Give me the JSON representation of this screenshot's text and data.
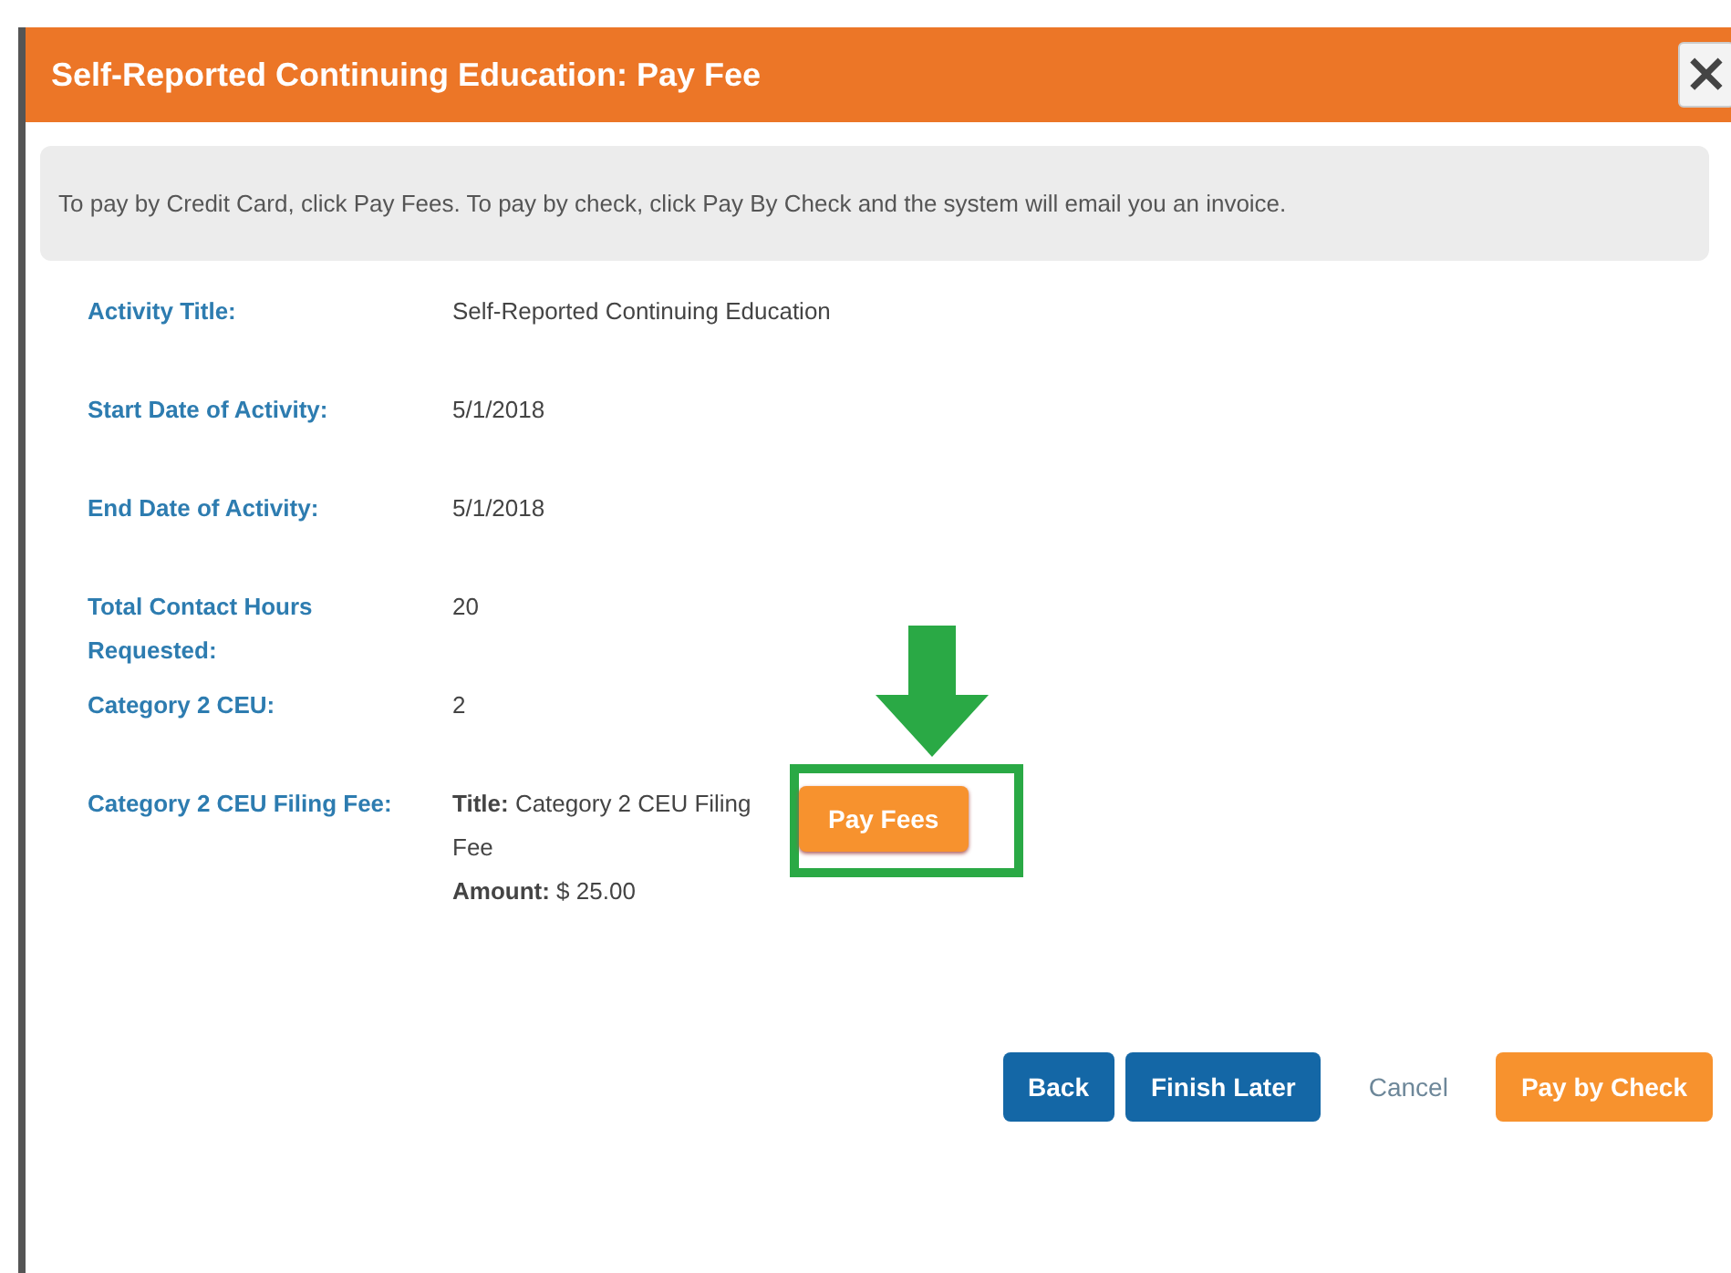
{
  "dialog": {
    "title": "Self-Reported Continuing Education: Pay Fee",
    "close_label": "×",
    "notice": "To pay by Credit Card, click Pay Fees.  To pay by check, click Pay By Check and the system will email you an invoice.",
    "fields": [
      {
        "kind": "text",
        "label": "Activity Title:",
        "value": "Self-Reported Continuing Education"
      },
      {
        "kind": "text",
        "label": "Start Date of Activity:",
        "value": "5/1/2018"
      },
      {
        "kind": "text",
        "label": "End Date of Activity:",
        "value": "5/1/2018"
      },
      {
        "kind": "text",
        "label": "Total Contact Hours Requested:",
        "value": "20"
      },
      {
        "kind": "text",
        "label": "Category 2 CEU:",
        "value": "2"
      },
      {
        "kind": "fee",
        "label": "Category 2 CEU Filing Fee:",
        "title_line": "**Title:** Category 2 CEU Filing Fee",
        "amount_line": "**Amount:** $ 25.00",
        "action": "Pay Fees",
        "highlighted": true
      }
    ],
    "buttons": [
      {
        "kind": "primary",
        "label": "Back"
      },
      {
        "kind": "primary",
        "label": "Finish Later"
      },
      {
        "kind": "link",
        "label": "Cancel"
      },
      {
        "kind": "accent",
        "label": "Pay by Check"
      }
    ]
  }
}
